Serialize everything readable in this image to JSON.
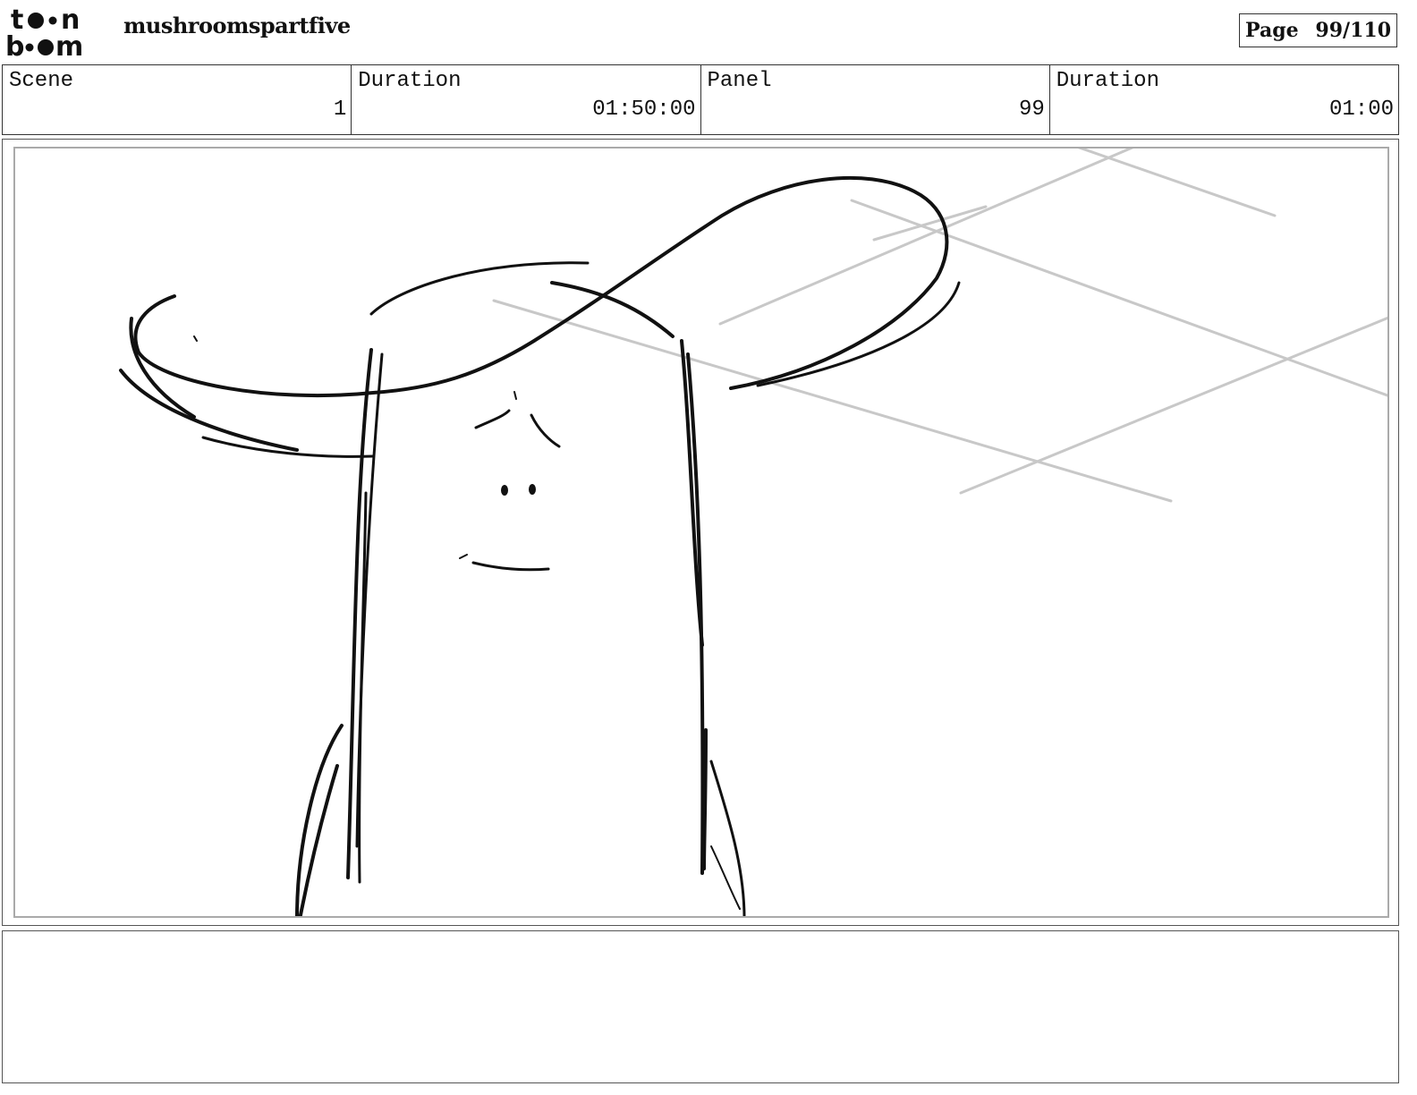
{
  "header": {
    "logo_text": "toon boom",
    "project_title": "mushroomspartfive",
    "page_label": "Page",
    "page_value": "99/110"
  },
  "info": {
    "scene_label": "Scene",
    "scene_value": "1",
    "scene_duration_label": "Duration",
    "scene_duration_value": "01:50:00",
    "panel_label": "Panel",
    "panel_value": "99",
    "panel_duration_label": "Duration",
    "panel_duration_value": "01:00"
  },
  "colors": {
    "ink": "#111111",
    "guide_lines": "#c8c8c8",
    "frame_border": "#aaaaaa"
  },
  "panel": {
    "content": "rough sketch drawing",
    "icons": [
      "toon-boom-logo"
    ]
  },
  "notes": {
    "text": ""
  }
}
